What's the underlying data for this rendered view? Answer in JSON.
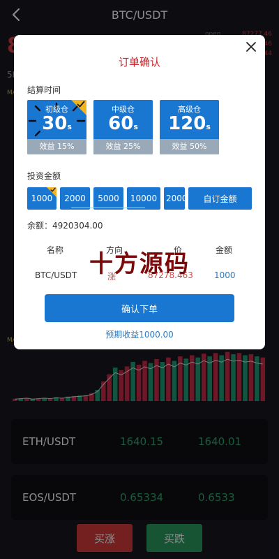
{
  "header": {
    "title": "BTC/USDT"
  },
  "background": {
    "price_prefix": "8",
    "open_label": "open",
    "stats": [
      "87277.46",
      "46",
      "44"
    ],
    "interval": "5M",
    "ma_label": "MA",
    "chart_bars": [
      {
        "v": 4,
        "c": "red"
      },
      {
        "v": 5,
        "c": "green"
      },
      {
        "v": 6,
        "c": "red"
      },
      {
        "v": 4,
        "c": "green"
      },
      {
        "v": 5,
        "c": "red"
      },
      {
        "v": 6,
        "c": "green"
      },
      {
        "v": 5,
        "c": "red"
      },
      {
        "v": 7,
        "c": "green"
      },
      {
        "v": 6,
        "c": "red"
      },
      {
        "v": 8,
        "c": "green"
      },
      {
        "v": 9,
        "c": "red"
      },
      {
        "v": 10,
        "c": "green"
      },
      {
        "v": 11,
        "c": "red"
      },
      {
        "v": 14,
        "c": "red"
      },
      {
        "v": 20,
        "c": "green"
      },
      {
        "v": 35,
        "c": "red"
      },
      {
        "v": 48,
        "c": "red"
      },
      {
        "v": 60,
        "c": "green"
      },
      {
        "v": 55,
        "c": "red"
      },
      {
        "v": 62,
        "c": "red"
      },
      {
        "v": 70,
        "c": "green"
      },
      {
        "v": 65,
        "c": "red"
      },
      {
        "v": 72,
        "c": "red"
      },
      {
        "v": 68,
        "c": "green"
      },
      {
        "v": 75,
        "c": "red"
      },
      {
        "v": 70,
        "c": "green"
      },
      {
        "v": 78,
        "c": "red"
      },
      {
        "v": 72,
        "c": "green"
      },
      {
        "v": 80,
        "c": "red"
      },
      {
        "v": 76,
        "c": "green"
      },
      {
        "v": 82,
        "c": "red"
      },
      {
        "v": 78,
        "c": "green"
      },
      {
        "v": 85,
        "c": "red"
      },
      {
        "v": 80,
        "c": "green"
      },
      {
        "v": 86,
        "c": "red"
      },
      {
        "v": 82,
        "c": "green"
      },
      {
        "v": 88,
        "c": "red"
      },
      {
        "v": 84,
        "c": "green"
      },
      {
        "v": 86,
        "c": "red"
      },
      {
        "v": 82,
        "c": "green"
      },
      {
        "v": 84,
        "c": "red"
      },
      {
        "v": 80,
        "c": "green"
      },
      {
        "v": 78,
        "c": "red"
      }
    ]
  },
  "markets": [
    {
      "symbol": "ETH/USDT",
      "price": "1640.15",
      "price2": "1640.01"
    },
    {
      "symbol": "EOS/USDT",
      "price": "0.65334",
      "price2": "0.6533"
    }
  ],
  "actions": {
    "buy_up": "买涨",
    "buy_down": "买跌"
  },
  "modal": {
    "title": "订单确认",
    "settle_label": "结算时间",
    "settle_options": [
      {
        "level": "初级仓",
        "seconds": "30",
        "unit": "s",
        "yield": "效益 15%",
        "selected": true
      },
      {
        "level": "中级仓",
        "seconds": "60",
        "unit": "s",
        "yield": "效益 25%",
        "selected": false
      },
      {
        "level": "高级仓",
        "seconds": "120",
        "unit": "s",
        "yield": "效益 50%",
        "selected": false
      }
    ],
    "amount_label": "投资金额",
    "amounts": [
      "1000",
      "2000",
      "5000",
      "10000",
      "2000"
    ],
    "custom_amount": "自订金额",
    "balance_label": "余额：",
    "balance_value": "4920304.00",
    "table_headers": [
      "名称",
      "方向",
      "价",
      "金额"
    ],
    "order": {
      "name": "BTC/USDT",
      "direction": "涨",
      "price": "87278.463",
      "amount": "1000"
    },
    "confirm_label": "确认下单",
    "expected_label": "预期收益1000.00",
    "watermark": "十方源码"
  },
  "colors": {
    "accent": "#1977d2",
    "up": "#c8282f",
    "down": "#2ea66c"
  }
}
